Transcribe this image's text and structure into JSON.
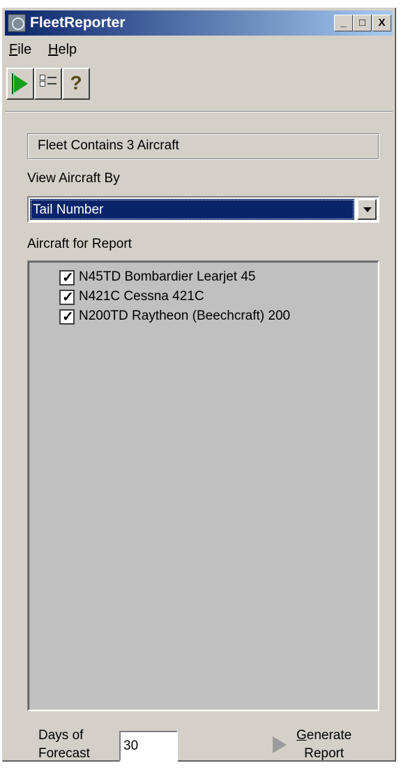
{
  "window": {
    "title": "FleetReporter",
    "controls": {
      "minimize": "_",
      "maximize": "□",
      "close": "X"
    }
  },
  "menu": [
    {
      "label": "File",
      "accel": "F",
      "rest": "ile"
    },
    {
      "label": "Help",
      "accel": "H",
      "rest": "elp"
    }
  ],
  "toolbar": {
    "icons": [
      "play-icon",
      "checklist-icon",
      "help-icon"
    ],
    "help_glyph": "?"
  },
  "fleet_status": "Fleet Contains 3 Aircraft",
  "view_by": {
    "label": "View Aircraft By",
    "selected": "Tail Number"
  },
  "aircraft_list": {
    "label": "Aircraft for Report",
    "items": [
      {
        "tail": "N45TD",
        "model": "Bombardier Learjet 45",
        "checked": true,
        "text": "N45TD  Bombardier Learjet 45"
      },
      {
        "tail": "N421C",
        "model": "Cessna 421C",
        "checked": true,
        "text": "N421C  Cessna 421C"
      },
      {
        "tail": "N200TD",
        "model": "Raytheon (Beechcraft) 200",
        "checked": true,
        "text": "N200TD  Raytheon (Beechcraft) 200"
      }
    ]
  },
  "forecast": {
    "label_line1": "Days of",
    "label_line2": "Forecast",
    "value": "30"
  },
  "generate_button": {
    "accel": "G",
    "line1_rest": "enerate",
    "line2": "Report"
  },
  "colors": {
    "titlebar_start": "#0a246a",
    "titlebar_end": "#a6caf0",
    "face": "#d4d0c8",
    "selection": "#0a246a",
    "play_green": "#16a01a"
  }
}
